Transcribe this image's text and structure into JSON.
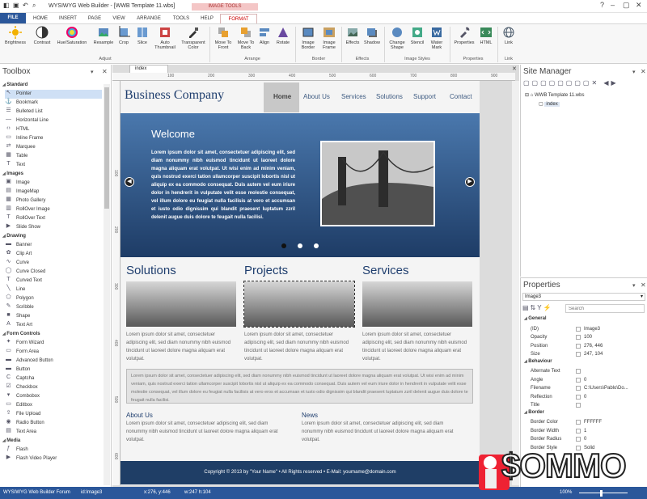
{
  "window": {
    "title": "WYSIWYG Web Builder - [WWB Template 11.wbs]",
    "controls": [
      "–",
      "▢",
      "✕"
    ],
    "help_icons": [
      "?",
      "^"
    ]
  },
  "tabs": [
    {
      "label": "FILE"
    },
    {
      "label": "HOME"
    },
    {
      "label": "INSERT"
    },
    {
      "label": "PAGE"
    },
    {
      "label": "VIEW"
    },
    {
      "label": "ARRANGE"
    },
    {
      "label": "TOOLS"
    },
    {
      "label": "HELP"
    },
    {
      "label": "FORMAT"
    }
  ],
  "contextual_tab_label": "IMAGE TOOLS",
  "ribbon": {
    "buttons": [
      {
        "label": "Brightness",
        "icon": "brightness-icon"
      },
      {
        "label": "Contrast",
        "icon": "contrast-icon"
      },
      {
        "label": "Hue/Saturation",
        "icon": "hue-icon"
      },
      {
        "label": "Resample",
        "icon": "resample-icon"
      },
      {
        "label": "Crop",
        "icon": "crop-icon"
      },
      {
        "label": "Slice",
        "icon": "slice-icon"
      },
      {
        "label": "Auto Thumbnail",
        "icon": "thumbnail-icon"
      },
      {
        "label": "Transparent Color",
        "icon": "eyedropper-icon"
      },
      {
        "label": "Move To Front",
        "icon": "front-icon"
      },
      {
        "label": "Move To Back",
        "icon": "back-icon"
      },
      {
        "label": "Align",
        "icon": "align-icon"
      },
      {
        "label": "Rotate",
        "icon": "rotate-icon"
      },
      {
        "label": "Image Border",
        "icon": "border-icon"
      },
      {
        "label": "Image Frame",
        "icon": "frame-icon"
      },
      {
        "label": "Effects",
        "icon": "effects-icon"
      },
      {
        "label": "Shadow",
        "icon": "shadow-icon"
      },
      {
        "label": "Change Shape",
        "icon": "shape-icon"
      },
      {
        "label": "Stencil",
        "icon": "stencil-icon"
      },
      {
        "label": "Water Mark",
        "icon": "watermark-icon"
      },
      {
        "label": "Properties",
        "icon": "properties-icon"
      },
      {
        "label": "HTML",
        "icon": "html-icon"
      },
      {
        "label": "Link",
        "icon": "link-icon"
      }
    ],
    "groups": [
      "Adjust",
      "Arrange",
      "Border",
      "Effects",
      "Image Styles",
      "Properties",
      "Link"
    ]
  },
  "toolbox": {
    "title": "Toolbox",
    "categories": [
      {
        "name": "Standard",
        "items": [
          {
            "label": "Pointer",
            "icon": "↖"
          },
          {
            "label": "Bookmark",
            "icon": "⚓"
          },
          {
            "label": "Bulleted List",
            "icon": "☰"
          },
          {
            "label": "Horizontal Line",
            "icon": "—"
          },
          {
            "label": "HTML",
            "icon": "‹›"
          },
          {
            "label": "Inline Frame",
            "icon": "▭"
          },
          {
            "label": "Marquee",
            "icon": "⇄"
          },
          {
            "label": "Table",
            "icon": "▦"
          },
          {
            "label": "Text",
            "icon": "T"
          }
        ]
      },
      {
        "name": "Images",
        "items": [
          {
            "label": "Image",
            "icon": "▣"
          },
          {
            "label": "ImageMap",
            "icon": "▤"
          },
          {
            "label": "Photo Gallery",
            "icon": "▦"
          },
          {
            "label": "RollOver Image",
            "icon": "▥"
          },
          {
            "label": "RollOver Text",
            "icon": "T"
          },
          {
            "label": "Slide Show",
            "icon": "▶"
          }
        ]
      },
      {
        "name": "Drawing",
        "items": [
          {
            "label": "Banner",
            "icon": "▬"
          },
          {
            "label": "Clip Art",
            "icon": "✿"
          },
          {
            "label": "Curve",
            "icon": "∿"
          },
          {
            "label": "Curve Closed",
            "icon": "◯"
          },
          {
            "label": "Curved Text",
            "icon": "T"
          },
          {
            "label": "Line",
            "icon": "╲"
          },
          {
            "label": "Polygon",
            "icon": "⬠"
          },
          {
            "label": "Scribble",
            "icon": "✎"
          },
          {
            "label": "Shape",
            "icon": "■"
          },
          {
            "label": "Text Art",
            "icon": "A"
          }
        ]
      },
      {
        "name": "Form Controls",
        "items": [
          {
            "label": "Form Wizard",
            "icon": "✦"
          },
          {
            "label": "Form Area",
            "icon": "▭"
          },
          {
            "label": "Advanced Button",
            "icon": "▬"
          },
          {
            "label": "Button",
            "icon": "▬"
          },
          {
            "label": "Captcha",
            "icon": "C"
          },
          {
            "label": "Checkbox",
            "icon": "☑"
          },
          {
            "label": "Combobox",
            "icon": "▾"
          },
          {
            "label": "Editbox",
            "icon": "▭"
          },
          {
            "label": "File Upload",
            "icon": "⇪"
          },
          {
            "label": "Radio Button",
            "icon": "◉"
          },
          {
            "label": "Text Area",
            "icon": "▤"
          }
        ]
      },
      {
        "name": "Media",
        "items": [
          {
            "label": "Flash",
            "icon": "ƒ"
          },
          {
            "label": "Flash Video Player",
            "icon": "▶"
          }
        ]
      }
    ]
  },
  "editor": {
    "doc_tab": "index",
    "ruler_marks": [
      "100",
      "200",
      "300",
      "400",
      "500",
      "600",
      "700",
      "800",
      "900"
    ],
    "ruler_v_marks": [
      "100",
      "200",
      "300",
      "400",
      "500",
      "600"
    ]
  },
  "site": {
    "brand": "Business Company",
    "nav": [
      "Home",
      "About Us",
      "Services",
      "Solutions",
      "Support",
      "Contact"
    ],
    "hero_title": "Welcome",
    "hero_text": "Lorem ipsum dolor sit amet, consectetuer adipiscing elit, sed diam nonummy nibh euismod tincidunt ut laoreet dolore magna aliquam erat volutpat. Ut wisi enim ad minim veniam, quis nostrud exerci tation ullamcorper suscipit lobortis nisl ut aliquip ex ea commodo consequat. Duis autem vel eum iriure dolor in hendrerit in vulputate velit esse molestie consequat, vel illum dolore eu feugiat nulla facilisis at vero et accumsan et iusto odio dignissim qui blandit praesent luptatum zzril delenit augue duis dolore te feugait nulla facilisi.",
    "columns": [
      {
        "title": "Solutions",
        "text": "Lorem ipsum dolor sit amet, consectetuer adipiscing elit, sed diam nonummy nibh euismod tincidunt ut laoreet dolore magna aliquam erat volutpat."
      },
      {
        "title": "Projects",
        "text": "Lorem ipsum dolor sit amet, consectetuer adipiscing elit, sed diam nonummy nibh euismod tincidunt ut laoreet dolore magna aliquam erat volutpat."
      },
      {
        "title": "Services",
        "text": "Lorem ipsum dolor sit amet, consectetuer adipiscing elit, sed diam nonummy nibh euismod tincidunt ut laoreet dolore magna aliquam erat volutpat."
      }
    ],
    "wide_text": "Lorem ipsum dolor sit amet, consectetuer adipiscing elit, sed diam nonummy nibh euismod tincidunt ut laoreet dolore magna aliquam erat volutpat. Ut wisi enim ad minim veniam, quis nostrud exerci tation ullamcorper suscipit lobortis nisl ut aliquip ex ea commodo consequat. Duis autem vel eum iriure dolor in hendrerit in vulputate velit esse molestie consequat, vel illum dolore eu feugiat nulla facilisis at vero eros et accumsan et iusto odio dignissim qui blandit praesent luptatum zzril delenit augue duis dolore te feugait nulla facilisi.",
    "about_title": "About Us",
    "about_text": "Lorem ipsum dolor sit amet, consectetuer adipiscing elit, sed diam nonummy nibh euismod tincidunt ut laoreet dolore magna aliquam erat volutpat.",
    "news_title": "News",
    "news_text": "Lorem ipsum dolor sit amet, consectetuer adipiscing elit, sed diam nonummy nibh euismod tincidunt ut laoreet dolore magna aliquam erat volutpat.",
    "footer": "Copyright © 2013 by \"Your Name\"   •   All Rights reserved   •   E-Mail: yourname@domain.com"
  },
  "site_manager": {
    "title": "Site Manager",
    "project": "WWB Template 11.wbs",
    "page": "index"
  },
  "properties": {
    "title": "Properties",
    "selected": "Image3",
    "search_placeholder": "Search",
    "groups": [
      {
        "name": "General",
        "rows": [
          {
            "k": "(ID)",
            "v": "Image3"
          },
          {
            "k": "Opacity",
            "v": "100"
          },
          {
            "k": "Position",
            "v": "276, 446"
          },
          {
            "k": "Size",
            "v": "247, 104"
          }
        ]
      },
      {
        "name": "Behaviour",
        "rows": [
          {
            "k": "Alternate Text",
            "v": ""
          },
          {
            "k": "Angle",
            "v": "0"
          },
          {
            "k": "Filename",
            "v": "C:\\Users\\Pablo\\Do..."
          },
          {
            "k": "Reflection",
            "v": "0"
          },
          {
            "k": "Title",
            "v": ""
          }
        ]
      },
      {
        "name": "Border",
        "rows": [
          {
            "k": "Border Color",
            "v": "FFFFFF"
          },
          {
            "k": "Border Width",
            "v": "1"
          },
          {
            "k": "Border Radius",
            "v": "0"
          },
          {
            "k": "Border Style",
            "v": "Solid"
          }
        ]
      }
    ]
  },
  "status": {
    "forum": "WYSIWYG Web Builder Forum",
    "id": "id:Image3",
    "coords": "x:276, y:446",
    "size": "w:247 h:104",
    "zoom": "100%"
  },
  "watermark": {
    "text": "$OMMO"
  },
  "colors": {
    "accent": "#2b579a",
    "brand": "#1f3e6e",
    "context": "#c00000"
  }
}
